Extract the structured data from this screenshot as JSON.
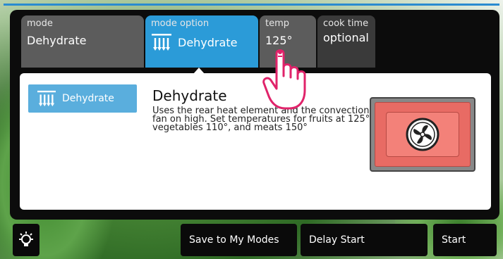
{
  "tabs": {
    "mode": {
      "label": "mode",
      "value": "Dehydrate"
    },
    "mode_option": {
      "label": "mode option",
      "value": "Dehydrate",
      "icon": "dehydrate-icon"
    },
    "temp": {
      "label": "temp",
      "value": "125°"
    },
    "cook_time": {
      "label": "cook time",
      "value": "optional"
    }
  },
  "selection": {
    "chip_label": "Dehydrate",
    "chip_icon": "dehydrate-icon"
  },
  "description": {
    "title": "Dehydrate",
    "body": "Uses the rear heat element and the convection fan on high. Set temperatures for fruits at 125°, vegetables 110°, and meats 150°"
  },
  "oven_icon": "convection-fan-icon",
  "bottom_bar": {
    "light_icon": "light-bulb-icon",
    "save_label": "Save to My Modes",
    "delay_label": "Delay Start",
    "start_label": "Start"
  },
  "colors": {
    "accent": "#2b9bd8",
    "tab_gray": "#5c5c5c",
    "oven_red": "#e86b64",
    "panel_black": "#0c0c0c"
  }
}
